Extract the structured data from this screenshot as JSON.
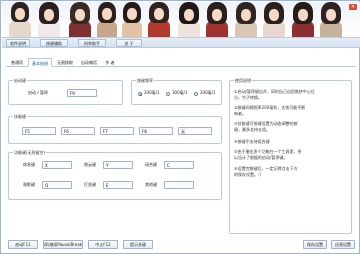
{
  "window": {
    "close_glyph": "✕"
  },
  "menu": {
    "items": [
      "软件说明",
      "按键辅助",
      "科举助手",
      "关 于"
    ]
  },
  "tabs": [
    "普通项",
    "基本按键",
    "无限按取",
    "自动喊话",
    "作 者"
  ],
  "groups": {
    "start": {
      "title": "启动键",
      "label": "启动 / 暂停",
      "key": "F9"
    },
    "interval": {
      "title": "按键频率",
      "options": [
        "200毫/1",
        "300毫/1",
        "200毫/1"
      ],
      "selected": 0
    },
    "skills": {
      "title": "技能键",
      "keys": [
        "F5",
        "F6",
        "F7",
        "F8",
        "无"
      ]
    },
    "functions": {
      "title": "功能键(无则留空)",
      "rows": [
        [
          {
            "label": "休息键",
            "key": "X"
          },
          {
            "label": "隐云键",
            "key": "Y"
          },
          {
            "label": "闭合键",
            "key": "C"
          }
        ],
        [
          {
            "label": "观影键",
            "key": "Q"
          },
          {
            "label": "打坐键",
            "key": "E"
          },
          {
            "label": "其他键",
            "key": ""
          }
        ]
      ]
    },
    "help": {
      "title": "使用说明",
      "lines": [
        "①启动/暂停键自开，同时自己自愿推挤中心位",
        "分，竹子转换。",
        "②按键间隔频率200毫秒，太快可能不影",
        "响者。",
        "③技能键可按键设置为动态调整的按",
        "键，最多支持五组。",
        "④按键不支持组合键",
        "⑤由于撤出多个功能在一个工具里，所",
        "以设计了根据的启动/暂停键。",
        "⑥设置完按键后，一定记得点击下方",
        "的保存设置。:)"
      ]
    }
  },
  "buttons": {
    "start": "启动F11",
    "pause": "停/继续Pause/Break",
    "stop": "中止F12",
    "hints": "提示关键",
    "save": "保存设置",
    "restore": "还原设置"
  },
  "colors": {
    "accent": "#1a5fb4",
    "border": "#9db4cf",
    "menubar": "#dfe8f2"
  }
}
